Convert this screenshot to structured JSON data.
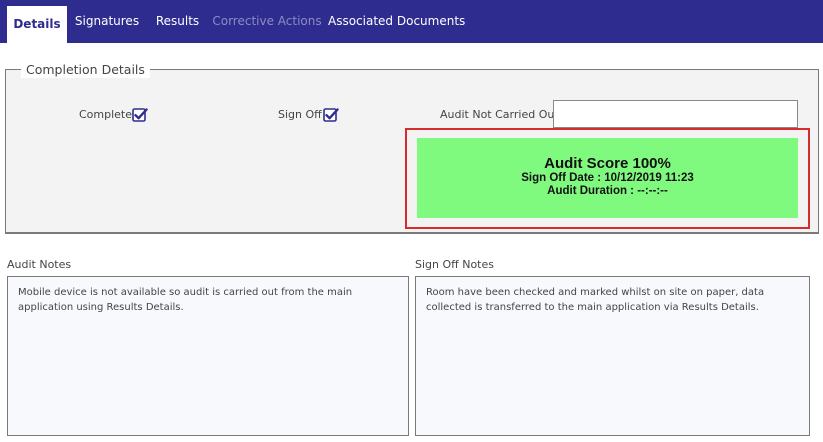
{
  "tabs": [
    {
      "label": "Details",
      "state": "active"
    },
    {
      "label": "Signatures",
      "state": "normal"
    },
    {
      "label": "Results",
      "state": "normal"
    },
    {
      "label": "Corrective Actions",
      "state": "disabled"
    },
    {
      "label": "Associated Documents",
      "state": "normal"
    }
  ],
  "completion": {
    "legend": "Completion Details",
    "complete_label": "Complete",
    "complete_checked": true,
    "signoff_label": "Sign Off",
    "signoff_checked": true,
    "not_carried_label": "Audit Not Carried Out",
    "not_carried_value": ""
  },
  "score": {
    "title": "Audit Score 100%",
    "signoff_date": "Sign Off Date : 10/12/2019 11:23",
    "duration": "Audit Duration : --:--:--"
  },
  "audit_notes": {
    "label": "Audit Notes",
    "text": "Mobile device is not available so audit is carried out from the main application using Results Details."
  },
  "signoff_notes": {
    "label": "Sign Off Notes",
    "text": "Room have been checked and marked whilst on site on paper, data collected is transferred to the main application via Results Details."
  },
  "colors": {
    "tabbar": "#2e2c8f",
    "score_bg": "#80f97f",
    "highlight_border": "#d82b2b",
    "checkbox": "#2e2c8f"
  }
}
